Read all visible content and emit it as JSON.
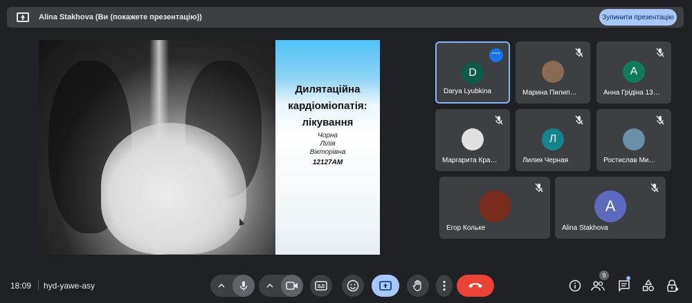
{
  "banner": {
    "title": "Alina Stakhova (Ви (покажете презентацію))",
    "stop_label": "Зупинити презентацію"
  },
  "slide": {
    "heading_lines": [
      "Дилятаційна",
      "кардіоміопатія:",
      "лікування"
    ],
    "author_lines": [
      "Чорна",
      "Лілія",
      "Вікторівна"
    ],
    "group": "12127АМ"
  },
  "participants": [
    {
      "name": "Darya Lyubkina",
      "initial": "D",
      "color": "#0b5d4a",
      "active": true
    },
    {
      "name": "Марина Пилип…",
      "initial": "",
      "color": "#8a6a52",
      "active": false
    },
    {
      "name": "Анна Грідіна 13…",
      "initial": "A",
      "color": "#0f7c5c",
      "active": false
    },
    {
      "name": "Маргарита Кра…",
      "initial": "",
      "color": "#e0e0e0",
      "active": false
    },
    {
      "name": "Лилия Черная",
      "initial": "Л",
      "color": "#12858f",
      "active": false
    },
    {
      "name": "Ростислав Ми…",
      "initial": "",
      "color": "#6a8fa8",
      "active": false
    },
    {
      "name": "Егор Кольке",
      "initial": "",
      "color": "#7a2d1f",
      "active": false
    },
    {
      "name": "Alina Stakhova",
      "initial": "A",
      "color": "#5c6bc0",
      "active": false
    }
  ],
  "bottom": {
    "time": "18:09",
    "meeting_code": "hyd-yawe-asy",
    "people_count": "9"
  },
  "colors": {
    "background": "#202124",
    "tile": "#3c4043",
    "accent": "#8ab4f8",
    "present_button": "#a8c7fa",
    "leave_button": "#ea4335"
  }
}
